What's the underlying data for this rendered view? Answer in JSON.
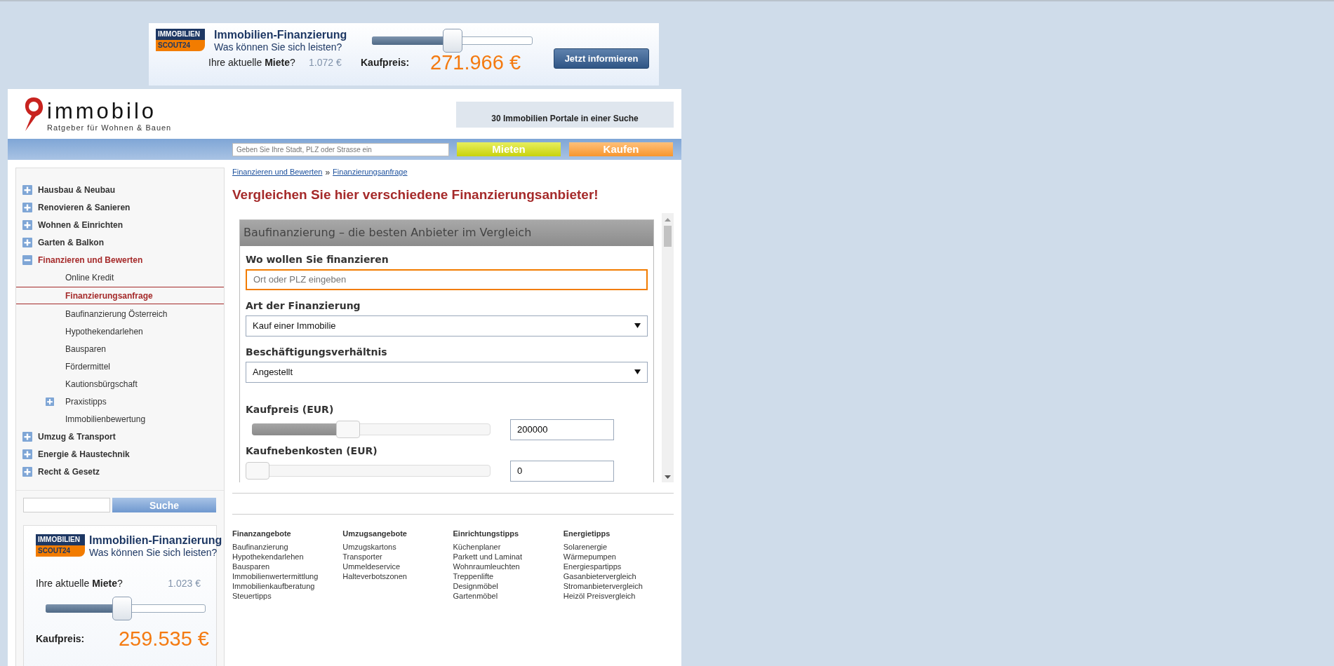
{
  "top_ad": {
    "logo_top": "IMMOBILIEN",
    "logo_bottom": "SCOUT24",
    "title": "Immobilien-Finanzierung",
    "subtitle": "Was können Sie sich leisten?",
    "rent_label": "Ihre aktuelle **Miete**?",
    "rent_value": "1.072 €",
    "level": 0.5,
    "price_label": "Kaufpreis:",
    "price_value": "271.966 €",
    "button": "Jetzt informieren"
  },
  "header": {
    "logo": "immobilo",
    "tagline": "Ratgeber für Wohnen & Bauen",
    "promo": "30 Immobilien Portale in einer Suche"
  },
  "nav": {
    "search": {
      "placeholder": "Geben Sie Ihre Stadt, PLZ oder Strasse ein"
    },
    "buttons": [
      {
        "label": "Mieten",
        "kind": "rent"
      },
      {
        "label": "Kaufen",
        "kind": "buy"
      }
    ]
  },
  "sidebar": {
    "items": [
      {
        "label": "Hausbau & Neubau",
        "expanded": false
      },
      {
        "label": "Renovieren & Sanieren",
        "expanded": false
      },
      {
        "label": "Wohnen & Einrichten",
        "expanded": false
      },
      {
        "label": "Garten & Balkon",
        "expanded": false
      },
      {
        "label": "Finanzieren und Bewerten",
        "expanded": true,
        "children": [
          {
            "label": "Online Kredit",
            "kind": "page",
            "selected": false
          },
          {
            "label": "Finanzierungsanfrage",
            "kind": "page",
            "selected": true
          },
          {
            "label": "Baufinanzierung Österreich",
            "kind": "page",
            "selected": false
          },
          {
            "label": "Hypothekendarlehen",
            "kind": "page",
            "selected": false
          },
          {
            "label": "Bausparen",
            "kind": "page",
            "selected": false
          },
          {
            "label": "Fördermittel",
            "kind": "page",
            "selected": false
          },
          {
            "label": "Kautionsbürgschaft",
            "kind": "page",
            "selected": false
          },
          {
            "label": "Praxistipps",
            "kind": "folder",
            "selected": false
          },
          {
            "label": "Immobilienbewertung",
            "kind": "page",
            "selected": false
          }
        ]
      },
      {
        "label": "Umzug & Transport",
        "expanded": false
      },
      {
        "label": "Energie & Haustechnik",
        "expanded": false
      },
      {
        "label": "Recht & Gesetz",
        "expanded": false
      }
    ],
    "search": {
      "button": "Suche"
    },
    "ad": {
      "logo_top": "IMMOBILIEN",
      "logo_bottom": "SCOUT24",
      "title": "Immobilien-Finanzierung",
      "subtitle": "Was können Sie sich leisten?",
      "rent_label": "Ihre aktuelle **Miete**?",
      "rent_value": "1.023 €",
      "level": 0.48,
      "price_label": "Kaufpreis:",
      "price_value": "259.535 €"
    }
  },
  "breadcrumb": {
    "items": [
      "Finanzieren und Bewerten",
      "Finanzierungsanfrage"
    ],
    "separator": "»"
  },
  "heading": "Vergleichen Sie hier verschiedene Finanzierungsanbieter!",
  "form": {
    "title": "Baufinanzierung – die besten Anbieter im Vergleich",
    "fields": [
      {
        "kind": "text",
        "label": "Wo wollen Sie finanzieren",
        "placeholder": "Ort oder PLZ eingeben",
        "focused": true
      },
      {
        "kind": "select",
        "label": "Art der Finanzierung",
        "value": "Kauf einer Immobilie"
      },
      {
        "kind": "select",
        "label": "Beschäftigungsverhältnis",
        "value": "Angestellt"
      },
      {
        "kind": "slider",
        "label": "Kaufpreis (EUR)",
        "level": 0.4,
        "value": "200000"
      },
      {
        "kind": "slider",
        "label": "Kaufnebenkosten (EUR)",
        "level": 0,
        "value": "0"
      }
    ]
  },
  "footer": {
    "columns": [
      {
        "title": "Finanzangebote",
        "links": [
          "Baufinanzierung",
          "Hypothekendarlehen",
          "Bausparen",
          "Immobilienwertermittlung",
          "Immobilienkaufberatung",
          "Steuertipps"
        ]
      },
      {
        "title": "Umzugsangebote",
        "links": [
          "Umzugskartons",
          "Transporter",
          "Ummeldeservice",
          "Halteverbotszonen"
        ]
      },
      {
        "title": "Einrichtungstipps",
        "links": [
          "Küchenplaner",
          "Parkett und Laminat",
          "Wohnraumleuchten",
          "Treppenlifte",
          "Designmöbel",
          "Gartenmöbel"
        ]
      },
      {
        "title": "Energietipps",
        "links": [
          "Solarenergie",
          "Wärmepumpen",
          "Energiespartipps",
          "Gasanbietervergleich",
          "Stromanbietervergleich",
          "Heizöl Preisvergleich"
        ]
      }
    ]
  }
}
